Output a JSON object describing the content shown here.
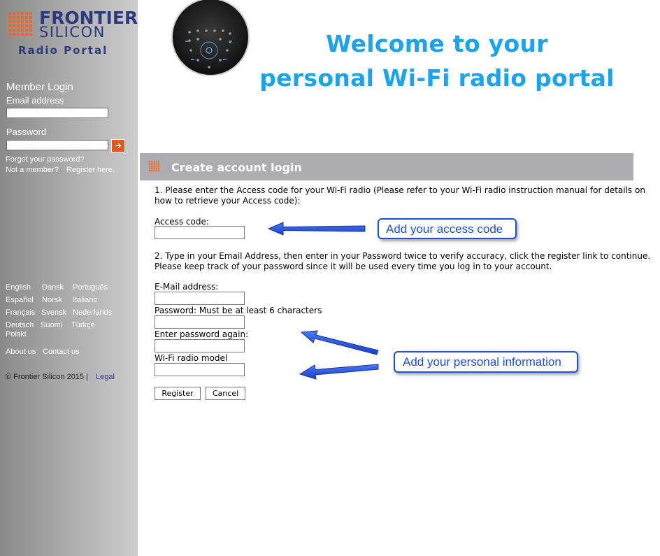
{
  "brand": {
    "line1": "FRONTIER",
    "line2": "SILICON",
    "sub": "Radio Portal",
    "grid_color": "#f26522",
    "text_color": "#2c3a7c"
  },
  "sidebar": {
    "member_login": "Member Login",
    "email_label": "Email address",
    "password_label": "Password",
    "go_icon": "arrow-right-icon",
    "go_glyph": "➔",
    "forgot": "Forgot your password?",
    "not_member": "Not a member?",
    "register_here": "Register here.",
    "languages": [
      "English",
      "Dansk",
      "Português",
      "Español",
      "Norsk",
      "Italiano",
      "Français",
      "Svensk",
      "Nederlands",
      "Deutsch",
      "Suomi",
      "Türkçe",
      "Polski"
    ],
    "about": "About us",
    "contact": "Contact us",
    "copyright": "© Frontier Silicon 2015 |",
    "legal": "Legal"
  },
  "header": {
    "welcome_line1": "Welcome to your",
    "welcome_line2": "personal Wi-Fi radio portal",
    "accent": "#1aa3ee"
  },
  "form": {
    "section_title": "Create account login",
    "step1_line1": "1. Please enter the Access code for your Wi-Fi radio (Please refer to your Wi-Fi radio instruction manual for details on",
    "step1_line2": "how to retrieve your Access code):",
    "access_code_label": "Access code:",
    "step2_line1": "2. Type in your Email Address, then enter in your Password twice to verify accuracy, click the register link to continue.",
    "step2_line2": "Please keep track of your password since it will be used every time you log in to your account.",
    "email_label": "E-Mail address:",
    "password_label": "Password: Must be at least 6 characters",
    "password_again_label": "Enter password again:",
    "model_label": "Wi-Fi radio model",
    "register_button": "Register",
    "cancel_button": "Cancel"
  },
  "annotations": {
    "access_code_callout": "Add your access code",
    "personal_info_callout": "Add your personal information",
    "color": "#1e4ee0"
  }
}
